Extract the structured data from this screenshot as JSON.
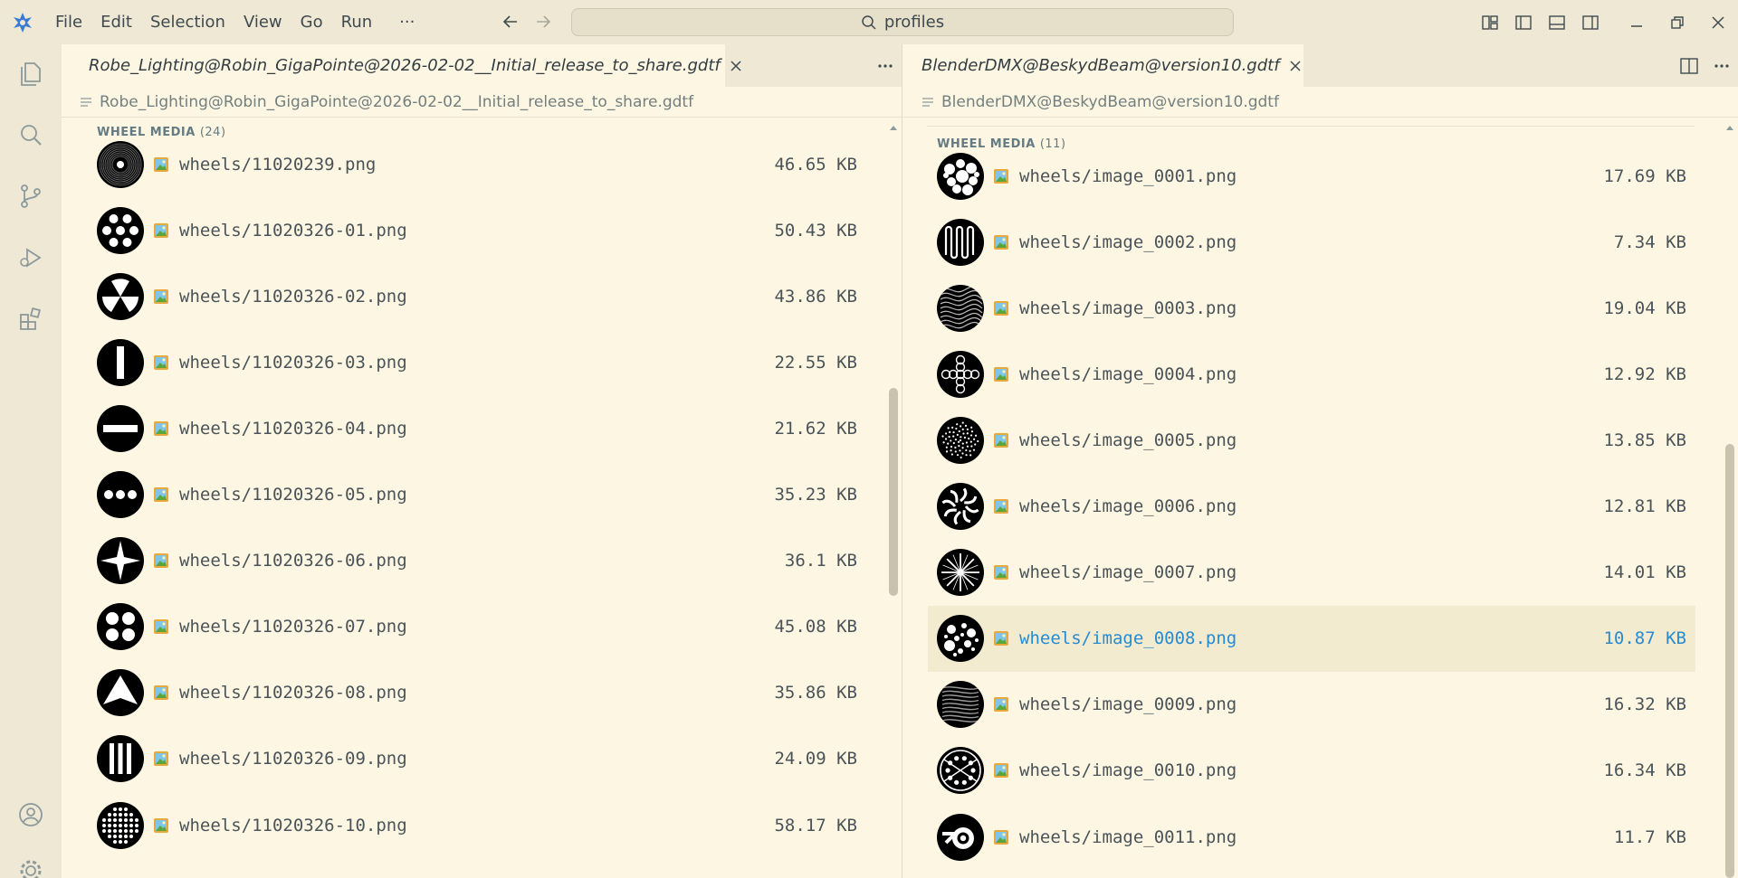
{
  "app": {
    "menu": [
      "File",
      "Edit",
      "Selection",
      "View",
      "Go",
      "Run"
    ],
    "more_label": "···",
    "search": "profiles",
    "accent": "#268bd2",
    "logo_color": "#3b7bd4"
  },
  "left": {
    "tab_label": "Robe_Lighting@Robin_GigaPointe@2026-02-02__Initial_release_to_share.gdtf",
    "breadcrumb": "Robe_Lighting@Robin_GigaPointe@2026-02-02__Initial_release_to_share.gdtf",
    "section_title": "WHEEL MEDIA",
    "section_count": "(24)",
    "files": [
      {
        "name": "wheels/11020239.png",
        "size": "46.65 KB",
        "thumb": "dot-ring"
      },
      {
        "name": "wheels/11020326-01.png",
        "size": "50.43 KB",
        "thumb": "seven-dots"
      },
      {
        "name": "wheels/11020326-02.png",
        "size": "43.86 KB",
        "thumb": "radiation"
      },
      {
        "name": "wheels/11020326-03.png",
        "size": "22.55 KB",
        "thumb": "vertical-bar"
      },
      {
        "name": "wheels/11020326-04.png",
        "size": "21.62 KB",
        "thumb": "horizontal-bar"
      },
      {
        "name": "wheels/11020326-05.png",
        "size": "35.23 KB",
        "thumb": "three-dots"
      },
      {
        "name": "wheels/11020326-06.png",
        "size": "36.1 KB",
        "thumb": "star"
      },
      {
        "name": "wheels/11020326-07.png",
        "size": "45.08 KB",
        "thumb": "four-dots"
      },
      {
        "name": "wheels/11020326-08.png",
        "size": "35.86 KB",
        "thumb": "triangle"
      },
      {
        "name": "wheels/11020326-09.png",
        "size": "24.09 KB",
        "thumb": "three-bars"
      },
      {
        "name": "wheels/11020326-10.png",
        "size": "58.17 KB",
        "thumb": "dot-grid"
      }
    ]
  },
  "right": {
    "tab_label": "BlenderDMX@BeskydBeam@version10.gdtf",
    "breadcrumb": "BlenderDMX@BeskydBeam@version10.gdtf",
    "section_title": "WHEEL MEDIA",
    "section_count": "(11)",
    "selected_index": 7,
    "files": [
      {
        "name": "wheels/image_0001.png",
        "size": "17.69 KB",
        "thumb": "blobs"
      },
      {
        "name": "wheels/image_0002.png",
        "size": "7.34 KB",
        "thumb": "zigzag"
      },
      {
        "name": "wheels/image_0003.png",
        "size": "19.04 KB",
        "thumb": "waves"
      },
      {
        "name": "wheels/image_0004.png",
        "size": "12.92 KB",
        "thumb": "cross-circles"
      },
      {
        "name": "wheels/image_0005.png",
        "size": "13.85 KB",
        "thumb": "speckle"
      },
      {
        "name": "wheels/image_0006.png",
        "size": "12.81 KB",
        "thumb": "swirl"
      },
      {
        "name": "wheels/image_0007.png",
        "size": "14.01 KB",
        "thumb": "burst"
      },
      {
        "name": "wheels/image_0008.png",
        "size": "10.87 KB",
        "thumb": "bubbles"
      },
      {
        "name": "wheels/image_0009.png",
        "size": "16.32 KB",
        "thumb": "weave"
      },
      {
        "name": "wheels/image_0010.png",
        "size": "16.34 KB",
        "thumb": "dotted-ring"
      },
      {
        "name": "wheels/image_0011.png",
        "size": "11.7 KB",
        "thumb": "blender-logo"
      }
    ]
  }
}
